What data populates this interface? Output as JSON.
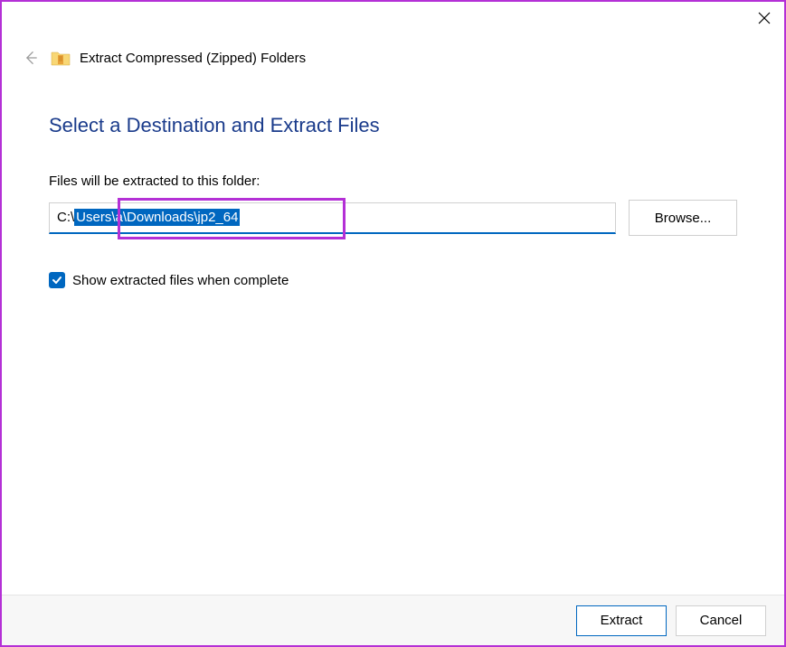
{
  "window": {
    "title": "Extract Compressed (Zipped) Folders"
  },
  "content": {
    "heading": "Select a Destination and Extract Files",
    "field_label": "Files will be extracted to this folder:",
    "path_prefix": "C:\\",
    "path_selected": "Users\\a\\Downloads\\jp2_64",
    "browse_label": "Browse...",
    "checkbox_label": "Show extracted files when complete",
    "checkbox_checked": true
  },
  "footer": {
    "extract_label": "Extract",
    "cancel_label": "Cancel"
  },
  "annotation": {
    "highlight_path_selection": true
  }
}
